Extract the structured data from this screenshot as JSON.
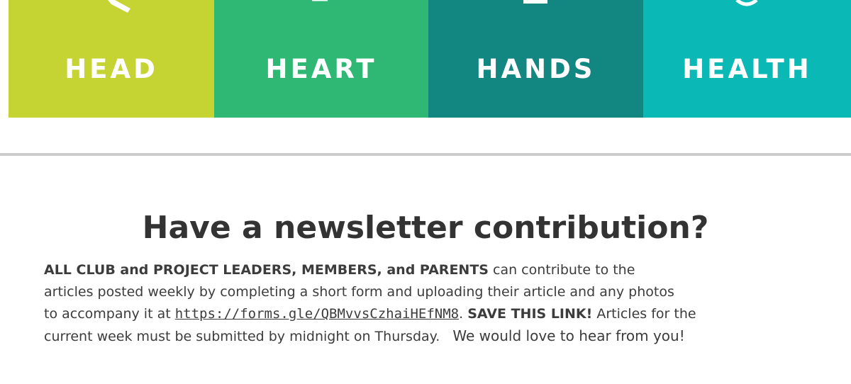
{
  "banner": {
    "panels": [
      {
        "label": "HEAD",
        "color": "#c5d433"
      },
      {
        "label": "HEART",
        "color": "#2eb873"
      },
      {
        "label": "HANDS",
        "color": "#128681"
      },
      {
        "label": "HEALTH",
        "color": "#0ab9b6"
      }
    ]
  },
  "section": {
    "title": "Have a newsletter contribution?",
    "lead_bold": "ALL CLUB and PROJECT LEADERS, MEMBERS, and PARENTS",
    "lead_rest": " can contribute to the",
    "line2": "articles posted weekly by completing a short form and uploading their article and any photos",
    "line3_pre": "to accompany it at ",
    "link_text": "https://forms.gle/QBMvvsCzhaiHEfNM8",
    "line3_sep": ". ",
    "save_bold": "SAVE THIS LINK!",
    "line3_post": " Articles for the",
    "line4": "current week must be submitted by midnight on Thursday.",
    "closing": "We would love to hear from you!"
  }
}
